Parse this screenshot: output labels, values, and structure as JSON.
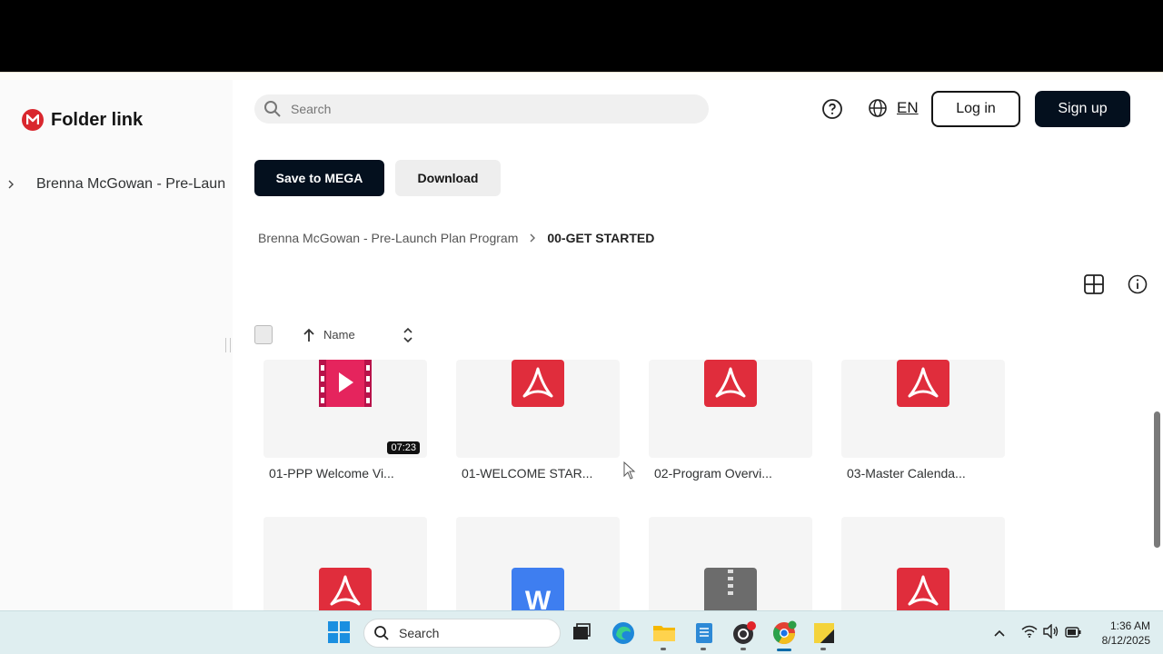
{
  "app": {
    "title": "Folder link"
  },
  "sidebar": {
    "tree_items": [
      {
        "label": "Brenna McGowan - Pre-Launch Plan Program"
      }
    ]
  },
  "header": {
    "search_placeholder": "Search",
    "language": "EN",
    "login_label": "Log in",
    "signup_label": "Sign up"
  },
  "actions": {
    "save_label": "Save to MEGA",
    "download_label": "Download"
  },
  "breadcrumb": {
    "parent": "Brenna McGowan - Pre-Launch Plan Program",
    "current": "00-GET STARTED"
  },
  "list_header": {
    "sort_label": "Name"
  },
  "files": [
    {
      "name": "01-PPP Welcome Vi...",
      "type": "video",
      "duration": "07:23"
    },
    {
      "name": "01-WELCOME STAR...",
      "type": "pdf"
    },
    {
      "name": "02-Program Overvi...",
      "type": "pdf"
    },
    {
      "name": "03-Master Calenda...",
      "type": "pdf"
    },
    {
      "name": "",
      "type": "pdf"
    },
    {
      "name": "",
      "type": "word"
    },
    {
      "name": "",
      "type": "zip"
    },
    {
      "name": "",
      "type": "pdf"
    }
  ],
  "taskbar": {
    "search_label": "Search",
    "time": "1:36 AM",
    "date": "8/12/2025"
  },
  "colors": {
    "brand": "#d9272e",
    "primary_button": "#04101e",
    "pdf": "#e02d3c",
    "video": "#e5245d",
    "word": "#3e7ef0",
    "zip": "#6c6c6c"
  }
}
